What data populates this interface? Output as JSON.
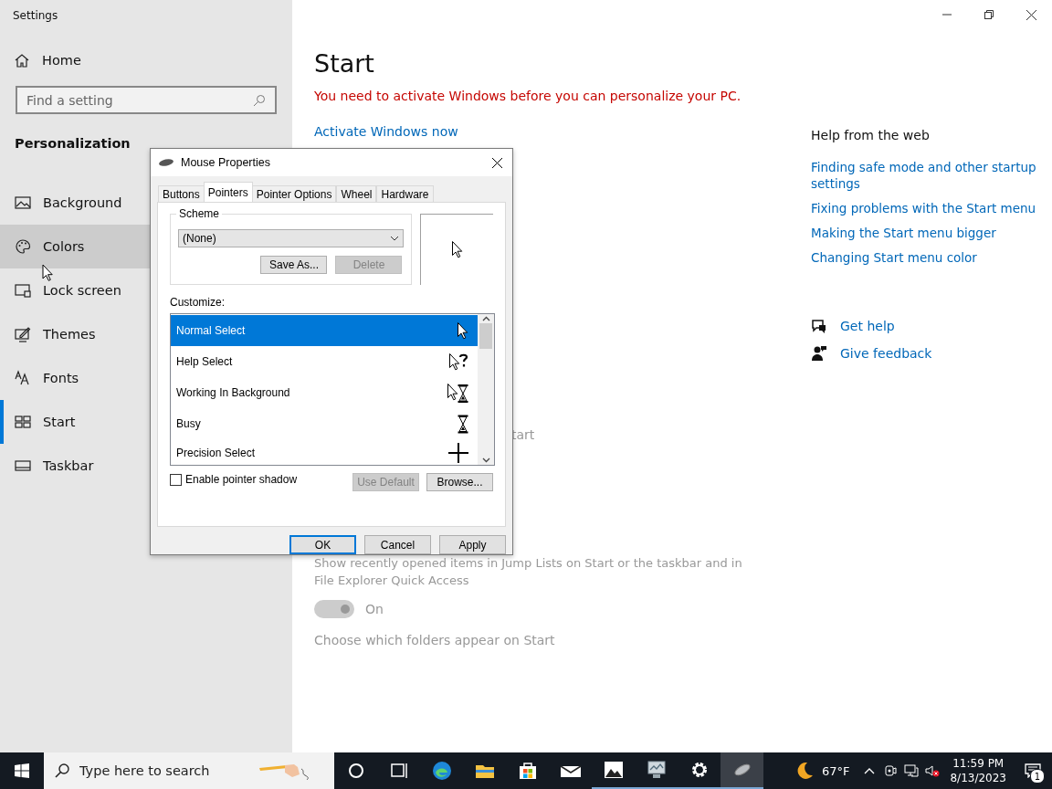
{
  "window": {
    "title": "Settings"
  },
  "sidebar": {
    "home": "Home",
    "search": {
      "placeholder": "Find a setting"
    },
    "section": "Personalization",
    "items": [
      {
        "label": "Background",
        "kind": "background",
        "hovered": false,
        "selected": false
      },
      {
        "label": "Colors",
        "kind": "colors",
        "hovered": true,
        "selected": false
      },
      {
        "label": "Lock screen",
        "kind": "lock",
        "hovered": false,
        "selected": false
      },
      {
        "label": "Themes",
        "kind": "themes",
        "hovered": false,
        "selected": false
      },
      {
        "label": "Fonts",
        "kind": "fonts",
        "hovered": false,
        "selected": false
      },
      {
        "label": "Start",
        "kind": "start",
        "hovered": false,
        "selected": true
      },
      {
        "label": "Taskbar",
        "kind": "taskbar",
        "hovered": false,
        "selected": false
      }
    ]
  },
  "main": {
    "title": "Start",
    "warning": "You need to activate Windows before you can personalize your PC.",
    "activate_link": "Activate Windows now",
    "partial_setting": "tart",
    "jump_lists": {
      "label": "Show recently opened items in Jump Lists on Start or the taskbar and in File Explorer Quick Access",
      "toggle": {
        "on": true,
        "disabled": true,
        "label": "On"
      }
    },
    "folders_link": "Choose which folders appear on Start"
  },
  "help": {
    "title": "Help from the web",
    "links": [
      "Finding safe mode and other startup settings",
      "Fixing problems with the Start menu",
      "Making the Start menu bigger",
      "Changing Start menu color"
    ],
    "actions": [
      {
        "label": "Get help",
        "kind": "help"
      },
      {
        "label": "Give feedback",
        "kind": "feedback"
      }
    ]
  },
  "dialog": {
    "title": "Mouse Properties",
    "tabs": [
      {
        "label": "Buttons",
        "selected": false
      },
      {
        "label": "Pointers",
        "selected": true
      },
      {
        "label": "Pointer Options",
        "selected": false
      },
      {
        "label": "Wheel",
        "selected": false
      },
      {
        "label": "Hardware",
        "selected": false
      }
    ],
    "scheme": {
      "legend": "Scheme",
      "value": "(None)",
      "buttons": [
        {
          "label": "Save As...",
          "disabled": false
        },
        {
          "label": "Delete",
          "disabled": true
        }
      ]
    },
    "customize_label": "Customize:",
    "pointers": [
      {
        "label": "Normal Select",
        "kind": "arrow",
        "selected": true
      },
      {
        "label": "Help Select",
        "kind": "help",
        "selected": false
      },
      {
        "label": "Working In Background",
        "kind": "working",
        "selected": false
      },
      {
        "label": "Busy",
        "kind": "busy",
        "selected": false
      },
      {
        "label": "Precision Select",
        "kind": "cross",
        "selected": false
      }
    ],
    "shadow": {
      "label": "Enable pointer shadow",
      "checked": false
    },
    "list_buttons": [
      {
        "label": "Use Default",
        "disabled": true
      },
      {
        "label": "Browse...",
        "disabled": false
      }
    ],
    "footer": [
      {
        "label": "OK",
        "default": true
      },
      {
        "label": "Cancel",
        "default": false
      },
      {
        "label": "Apply",
        "default": false
      }
    ]
  },
  "taskbar": {
    "search_placeholder": "Type here to search",
    "apps": [
      {
        "kind": "cortana",
        "running": false,
        "active": false
      },
      {
        "kind": "taskview",
        "running": false,
        "active": false
      },
      {
        "kind": "edge",
        "running": false,
        "active": false
      },
      {
        "kind": "explorer",
        "running": false,
        "active": false
      },
      {
        "kind": "store",
        "running": false,
        "active": false
      },
      {
        "kind": "mail",
        "running": false,
        "active": false
      },
      {
        "kind": "photos",
        "running": true,
        "active": false
      },
      {
        "kind": "computer",
        "running": true,
        "active": false
      },
      {
        "kind": "settings",
        "running": true,
        "active": false
      },
      {
        "kind": "mouse",
        "running": true,
        "active": true
      }
    ],
    "weather": "67°F",
    "time": "11:59 PM",
    "date": "8/13/2023",
    "notifications": "1"
  }
}
